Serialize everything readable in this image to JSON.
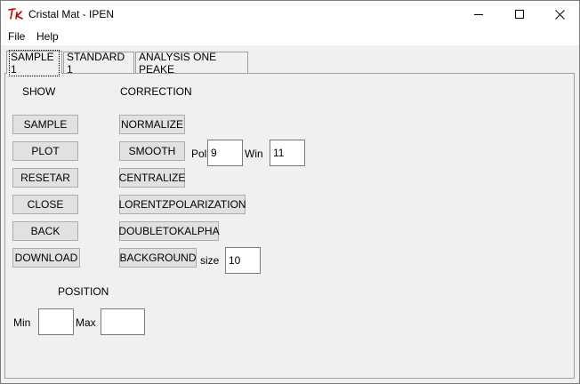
{
  "window": {
    "title": "Cristal Mat - IPEN",
    "app_icon": "tk-feather-icon",
    "controls": {
      "minimize": "minimize-icon",
      "maximize": "maximize-icon",
      "close": "close-icon"
    }
  },
  "menubar": {
    "items": [
      {
        "label": "File"
      },
      {
        "label": "Help"
      }
    ]
  },
  "tabs": [
    {
      "label": "SAMPLE 1",
      "active": true
    },
    {
      "label": "STANDARD 1",
      "active": false
    },
    {
      "label": "ANALYSIS ONE PEAKE",
      "active": false
    }
  ],
  "show": {
    "heading": "SHOW",
    "buttons": [
      {
        "label": "SAMPLE"
      },
      {
        "label": "PLOT"
      },
      {
        "label": "RESETAR"
      },
      {
        "label": "CLOSE"
      },
      {
        "label": "BACK"
      },
      {
        "label": "DOWNLOAD"
      }
    ]
  },
  "correction": {
    "heading": "CORRECTION",
    "buttons": [
      {
        "label": "NORMALIZE"
      },
      {
        "label": "SMOOTH"
      },
      {
        "label": "CENTRALIZE"
      },
      {
        "label": "LORENTZPOLARIZATION"
      },
      {
        "label": "DOUBLETOKALPHA"
      },
      {
        "label": "BACKGROUND"
      }
    ],
    "smooth_params": {
      "pol_label": "Pol",
      "pol_value": "9",
      "win_label": "Win",
      "win_value": "11"
    },
    "background_params": {
      "size_label": "size",
      "size_value": "10"
    }
  },
  "position": {
    "heading": "POSITION",
    "min_label": "Min",
    "min_value": "",
    "max_label": "Max",
    "max_value": ""
  }
}
